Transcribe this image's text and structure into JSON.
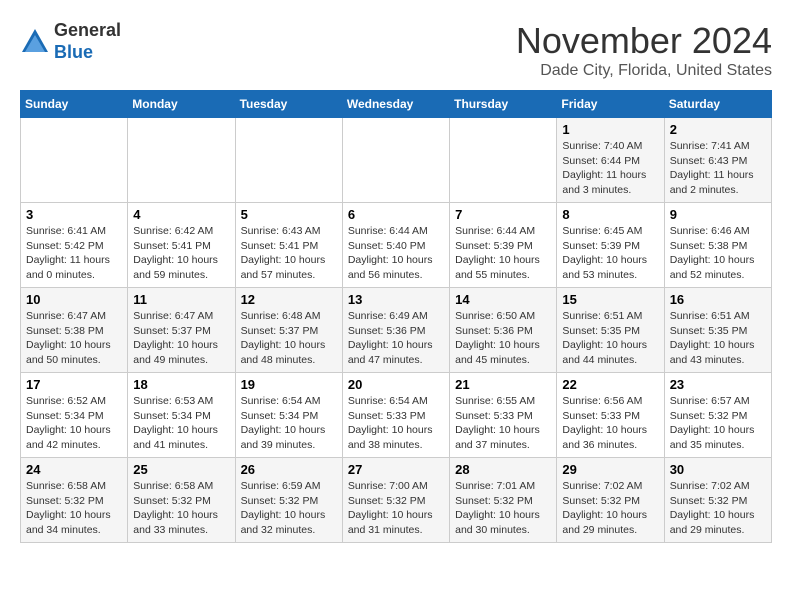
{
  "logo": {
    "general": "General",
    "blue": "Blue"
  },
  "title": "November 2024",
  "subtitle": "Dade City, Florida, United States",
  "days_of_week": [
    "Sunday",
    "Monday",
    "Tuesday",
    "Wednesday",
    "Thursday",
    "Friday",
    "Saturday"
  ],
  "weeks": [
    [
      {
        "day": "",
        "info": ""
      },
      {
        "day": "",
        "info": ""
      },
      {
        "day": "",
        "info": ""
      },
      {
        "day": "",
        "info": ""
      },
      {
        "day": "",
        "info": ""
      },
      {
        "day": "1",
        "info": "Sunrise: 7:40 AM\nSunset: 6:44 PM\nDaylight: 11 hours\nand 3 minutes."
      },
      {
        "day": "2",
        "info": "Sunrise: 7:41 AM\nSunset: 6:43 PM\nDaylight: 11 hours\nand 2 minutes."
      }
    ],
    [
      {
        "day": "3",
        "info": "Sunrise: 6:41 AM\nSunset: 5:42 PM\nDaylight: 11 hours\nand 0 minutes."
      },
      {
        "day": "4",
        "info": "Sunrise: 6:42 AM\nSunset: 5:41 PM\nDaylight: 10 hours\nand 59 minutes."
      },
      {
        "day": "5",
        "info": "Sunrise: 6:43 AM\nSunset: 5:41 PM\nDaylight: 10 hours\nand 57 minutes."
      },
      {
        "day": "6",
        "info": "Sunrise: 6:44 AM\nSunset: 5:40 PM\nDaylight: 10 hours\nand 56 minutes."
      },
      {
        "day": "7",
        "info": "Sunrise: 6:44 AM\nSunset: 5:39 PM\nDaylight: 10 hours\nand 55 minutes."
      },
      {
        "day": "8",
        "info": "Sunrise: 6:45 AM\nSunset: 5:39 PM\nDaylight: 10 hours\nand 53 minutes."
      },
      {
        "day": "9",
        "info": "Sunrise: 6:46 AM\nSunset: 5:38 PM\nDaylight: 10 hours\nand 52 minutes."
      }
    ],
    [
      {
        "day": "10",
        "info": "Sunrise: 6:47 AM\nSunset: 5:38 PM\nDaylight: 10 hours\nand 50 minutes."
      },
      {
        "day": "11",
        "info": "Sunrise: 6:47 AM\nSunset: 5:37 PM\nDaylight: 10 hours\nand 49 minutes."
      },
      {
        "day": "12",
        "info": "Sunrise: 6:48 AM\nSunset: 5:37 PM\nDaylight: 10 hours\nand 48 minutes."
      },
      {
        "day": "13",
        "info": "Sunrise: 6:49 AM\nSunset: 5:36 PM\nDaylight: 10 hours\nand 47 minutes."
      },
      {
        "day": "14",
        "info": "Sunrise: 6:50 AM\nSunset: 5:36 PM\nDaylight: 10 hours\nand 45 minutes."
      },
      {
        "day": "15",
        "info": "Sunrise: 6:51 AM\nSunset: 5:35 PM\nDaylight: 10 hours\nand 44 minutes."
      },
      {
        "day": "16",
        "info": "Sunrise: 6:51 AM\nSunset: 5:35 PM\nDaylight: 10 hours\nand 43 minutes."
      }
    ],
    [
      {
        "day": "17",
        "info": "Sunrise: 6:52 AM\nSunset: 5:34 PM\nDaylight: 10 hours\nand 42 minutes."
      },
      {
        "day": "18",
        "info": "Sunrise: 6:53 AM\nSunset: 5:34 PM\nDaylight: 10 hours\nand 41 minutes."
      },
      {
        "day": "19",
        "info": "Sunrise: 6:54 AM\nSunset: 5:34 PM\nDaylight: 10 hours\nand 39 minutes."
      },
      {
        "day": "20",
        "info": "Sunrise: 6:54 AM\nSunset: 5:33 PM\nDaylight: 10 hours\nand 38 minutes."
      },
      {
        "day": "21",
        "info": "Sunrise: 6:55 AM\nSunset: 5:33 PM\nDaylight: 10 hours\nand 37 minutes."
      },
      {
        "day": "22",
        "info": "Sunrise: 6:56 AM\nSunset: 5:33 PM\nDaylight: 10 hours\nand 36 minutes."
      },
      {
        "day": "23",
        "info": "Sunrise: 6:57 AM\nSunset: 5:32 PM\nDaylight: 10 hours\nand 35 minutes."
      }
    ],
    [
      {
        "day": "24",
        "info": "Sunrise: 6:58 AM\nSunset: 5:32 PM\nDaylight: 10 hours\nand 34 minutes."
      },
      {
        "day": "25",
        "info": "Sunrise: 6:58 AM\nSunset: 5:32 PM\nDaylight: 10 hours\nand 33 minutes."
      },
      {
        "day": "26",
        "info": "Sunrise: 6:59 AM\nSunset: 5:32 PM\nDaylight: 10 hours\nand 32 minutes."
      },
      {
        "day": "27",
        "info": "Sunrise: 7:00 AM\nSunset: 5:32 PM\nDaylight: 10 hours\nand 31 minutes."
      },
      {
        "day": "28",
        "info": "Sunrise: 7:01 AM\nSunset: 5:32 PM\nDaylight: 10 hours\nand 30 minutes."
      },
      {
        "day": "29",
        "info": "Sunrise: 7:02 AM\nSunset: 5:32 PM\nDaylight: 10 hours\nand 29 minutes."
      },
      {
        "day": "30",
        "info": "Sunrise: 7:02 AM\nSunset: 5:32 PM\nDaylight: 10 hours\nand 29 minutes."
      }
    ]
  ]
}
